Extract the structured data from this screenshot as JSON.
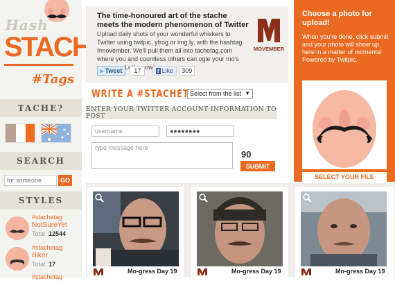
{
  "logo": {
    "hash": "Hash",
    "stache": "STACHE",
    "tags": "#Tags"
  },
  "sidebar": {
    "tache_heading": "TACHE?",
    "search_heading": "SEARCH",
    "search_placeholder": "for someone",
    "search_go": "GO",
    "styles_heading": "STYLES",
    "styles": [
      {
        "tag": "#stachetag",
        "name": "NotSureYet",
        "total_label": "Total:",
        "total": "12544"
      },
      {
        "tag": "#stachetag",
        "name": "Biker",
        "total_label": "Total:",
        "total": "17"
      },
      {
        "tag": "#stachetag"
      }
    ]
  },
  "info": {
    "title": "The time-honoured art of the stache meets the modern phenomenon of Twitter",
    "body": "Upload daily shots of your wonderful whiskers to Twitter using twitpic, yfrog or img.ly, with the hashtag #movember. We'll pull them all into tachetag.com where you and countless others can ogle your mo's progress. Let's grow!",
    "movember": "MOVEMBER",
    "tweet_label": "Tweet",
    "tweet_count": "17",
    "like_label": "Like",
    "like_count": "309"
  },
  "compose": {
    "write_title": "WRITE A #STACHETAG -",
    "select_value": "Select from the list",
    "enter_banner": "ENTER YOUR TWITTER ACCOUNT INFORMATION TO POST",
    "username_placeholder": "username",
    "password_value": "●●●●●●●●",
    "message_placeholder": "type message here",
    "char_count": "90",
    "submit": "SUBMIT"
  },
  "upload": {
    "title": "Choose a photo for upload!",
    "body": "When you're done, click submit and your photo will show up here in a matter of moments! Powered by Twitpic.",
    "button": "SELECT YOUR FILE"
  },
  "gallery": [
    {
      "caption": "Mo-gress Day 19"
    },
    {
      "caption": "Mo-gress Day 19"
    },
    {
      "caption": "Mo-gress Day 19"
    }
  ],
  "colors": {
    "accent": "#ea6a21",
    "panel": "#f0efec"
  }
}
